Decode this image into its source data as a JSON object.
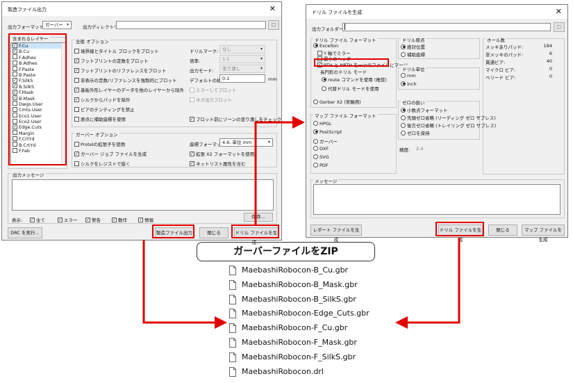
{
  "left": {
    "title": "製造ファイル出力",
    "format_label": "出力フォーマット:",
    "format_value": "ガーバー",
    "dir_label": "出力ディレクトリー:",
    "layers_group": "含まれるレイヤー",
    "layers": [
      {
        "name": "F.Cu",
        "checked": true,
        "selected": true
      },
      {
        "name": "B.Cu",
        "checked": true
      },
      {
        "name": "F.Adhes",
        "checked": false
      },
      {
        "name": "B.Adhes",
        "checked": false
      },
      {
        "name": "F.Paste",
        "checked": false
      },
      {
        "name": "B.Paste",
        "checked": false
      },
      {
        "name": "F.SilkS",
        "checked": true
      },
      {
        "name": "B.SilkS",
        "checked": true
      },
      {
        "name": "F.Mask",
        "checked": true
      },
      {
        "name": "B.Mask",
        "checked": true
      },
      {
        "name": "Dwgs.User",
        "checked": false
      },
      {
        "name": "Cmts.User",
        "checked": false
      },
      {
        "name": "Eco1.User",
        "checked": false
      },
      {
        "name": "Eco2.User",
        "checked": false
      },
      {
        "name": "Edge.Cuts",
        "checked": true
      },
      {
        "name": "Margin",
        "checked": false
      },
      {
        "name": "F.CrtYd",
        "checked": false
      },
      {
        "name": "B.CrtYd",
        "checked": false
      },
      {
        "name": "F.Fab",
        "checked": false
      }
    ],
    "general_group": "全般 オプション",
    "general_opts": [
      {
        "label": "境界線とタイトル ブロックをプロット",
        "checked": false
      },
      {
        "label": "フットプリントの定数をプロット",
        "checked": true
      },
      {
        "label": "フットプリントのリファレンスをプロット",
        "checked": true
      },
      {
        "label": "非表示の定数/リファレンスを強制的にプロット",
        "checked": false
      },
      {
        "label": "基板外形レイヤーのデータを他のレイヤーから除外",
        "checked": true
      },
      {
        "label": "シルクからパッドを除外",
        "checked": true
      },
      {
        "label": "ビアのテンティングを禁止",
        "checked": false
      },
      {
        "label": "原点に補助座標を使用",
        "checked": false
      }
    ],
    "drill_mark_label": "ドリルマーク:",
    "drill_mark_value": "なし",
    "scale_label": "倍率:",
    "scale_value": "1:1",
    "plot_mode_label": "出力モード:",
    "plot_mode_value": "塗り潰し",
    "line_width_label": "デフォルトの線幅:",
    "line_width_value": "0.1",
    "line_width_unit": "mm",
    "mirror_label": "ミラーしてプロット",
    "neg_label": "ネガ出力プロット",
    "zone_fill_label": "プロット前にゾーンの塗り潰しをチェック",
    "gerber_group": "ガーバー オプション",
    "gerber_opts": [
      {
        "label": "Protelの拡張子を使用",
        "checked": false
      },
      {
        "label": "ガーバー ジョブ ファイルを生成",
        "checked": true
      },
      {
        "label": "シルクをレジストで抜く",
        "checked": false
      }
    ],
    "coord_label": "座標フォーマット:",
    "coord_value": "4.6, 単位 mm",
    "x2_label": "拡張 X2 フォーマットを使用",
    "x2_checked": true,
    "netlist_label": "ネットリスト属性を含む",
    "netlist_checked": true,
    "msg_group": "出力メッセージ",
    "show_label": "表示:",
    "filters": [
      {
        "label": "全て"
      },
      {
        "label": "エラー"
      },
      {
        "label": "警告"
      },
      {
        "label": "動作"
      },
      {
        "label": "情報"
      }
    ],
    "save_btn": "保存...",
    "drc_btn": "DRC を実行...",
    "plot_btn": "製造ファイル出力",
    "close_btn": "閉じる",
    "drill_btn": "ドリル ファイルを生成..."
  },
  "right": {
    "title": "ドリル ファイルを生成",
    "folder_label": "出力フォルダー:",
    "drill_format_group": "ドリル ファイル フォーマット",
    "excellon": "Excellon",
    "mirror_y": "Y 軸でミラー",
    "min_header": "最小のヘッダー",
    "merge_pth": "PTH と NPTH を一つのファイルにマージ",
    "oval_group": "長円形のドリル モード",
    "route_cmd": "route コマンドを使用 (推奨)",
    "alt_mode": "代替ドリル モードを使用",
    "gerber_x2": "Gerber X2 (実験用)",
    "map_group": "マップ ファイル フォーマット",
    "map_opts": [
      {
        "label": "HPGL",
        "on": false
      },
      {
        "label": "PostScript",
        "on": true
      },
      {
        "label": "ガーバー",
        "on": false
      },
      {
        "label": "DXF",
        "on": false
      },
      {
        "label": "SVG",
        "on": false
      },
      {
        "label": "PDF",
        "on": false
      }
    ],
    "origin_group": "ドリル原点",
    "origin_opts": [
      {
        "label": "絶対位置",
        "on": true
      },
      {
        "label": "補助座標",
        "on": false
      }
    ],
    "units_group": "ドリル単位",
    "units_opts": [
      {
        "label": "mm",
        "on": false
      },
      {
        "label": "inch",
        "on": true
      }
    ],
    "zeros_group": "ゼロの扱い",
    "zeros_opts": [
      {
        "label": "小数点フォーマット",
        "on": true
      },
      {
        "label": "先頭ゼロ省略 (リーディング ゼロ サプレス)",
        "on": false
      },
      {
        "label": "後方ゼロ省略 (トレイリング ゼロ サプレス)",
        "on": false
      },
      {
        "label": "ゼロを保持",
        "on": false
      }
    ],
    "precision_label": "精度:",
    "precision_value": "2:4",
    "holes_group": "ホール数",
    "holes": [
      {
        "label": "メッキありパッド:",
        "value": "184"
      },
      {
        "label": "非メッキのパッド:",
        "value": "6"
      },
      {
        "label": "貫通ビア:",
        "value": "40"
      },
      {
        "label": "マイクロ ビア:",
        "value": "0"
      },
      {
        "label": "ベリード ビア:",
        "value": "0"
      }
    ],
    "msg_group": "メッセージ",
    "report_btn": "レポート ファイルを生成",
    "gen_btn": "ドリル ファイルを生成",
    "close_btn": "閉じる",
    "map_btn": "マップ ファイルを生成"
  },
  "zip_title": "ガーバーファイルをZIP",
  "files": [
    "MaebashiRobocon-B_Cu.gbr",
    "MaebashiRobocon-B_Mask.gbr",
    "MaebashiRobocon-B_SilkS.gbr",
    "MaebashiRobocon-Edge_Cuts.gbr",
    "MaebashiRobocon-F_Cu.gbr",
    "MaebashiRobocon-F_Mask.gbr",
    "MaebashiRobocon-F_SilkS.gbr",
    "MaebashiRobocon.drl"
  ],
  "colors": {
    "highlight": "#e20000",
    "dialog_bg": "#f0f0f0",
    "selection": "#cce4f7"
  }
}
